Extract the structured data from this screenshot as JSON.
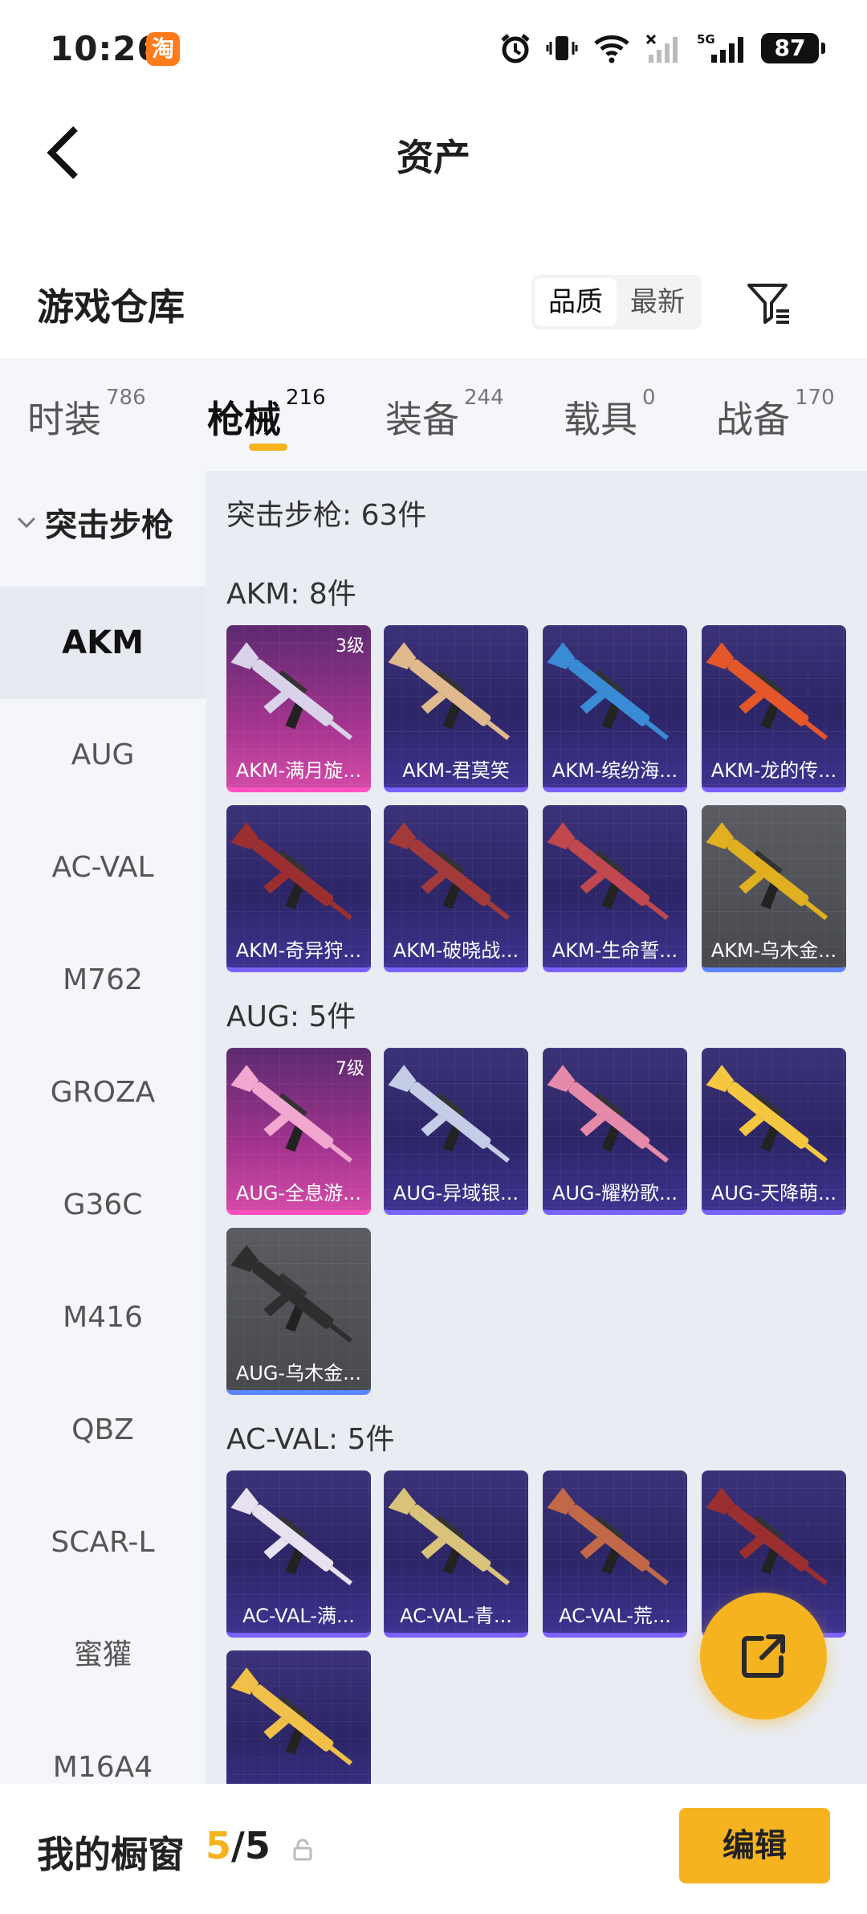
{
  "status_bar": {
    "time": "10:26",
    "app_badge": "淘",
    "battery": "87",
    "network": "5G"
  },
  "nav": {
    "title": "资产",
    "back_icon": "chevron-left-icon"
  },
  "warehouse": {
    "title": "游戏仓库",
    "sort_options": [
      "品质",
      "最新"
    ],
    "selected_sort": "品质"
  },
  "tabs": [
    {
      "label": "时装",
      "count": "786"
    },
    {
      "label": "枪械",
      "count": "216"
    },
    {
      "label": "装备",
      "count": "244"
    },
    {
      "label": "载具",
      "count": "0"
    },
    {
      "label": "战备",
      "count": "170"
    }
  ],
  "active_tab": "枪械",
  "sidebar": {
    "group": "突击步枪",
    "items": [
      "AKM",
      "AUG",
      "AC-VAL",
      "M762",
      "GROZA",
      "G36C",
      "M416",
      "QBZ",
      "SCAR-L",
      "蜜獾",
      "M16A4"
    ],
    "active": "AKM"
  },
  "content": {
    "summary": "突击步枪: 63件",
    "groups": [
      {
        "title": "AKM: 8件",
        "items": [
          {
            "name": "AKM-满月旋...",
            "level": "3级",
            "rarity": "pink"
          },
          {
            "name": "AKM-君莫笑",
            "level": "",
            "rarity": "purple"
          },
          {
            "name": "AKM-缤纷海...",
            "level": "",
            "rarity": "purple"
          },
          {
            "name": "AKM-龙的传...",
            "level": "",
            "rarity": "purple"
          },
          {
            "name": "AKM-奇异狩...",
            "level": "",
            "rarity": "purple"
          },
          {
            "name": "AKM-破晓战...",
            "level": "",
            "rarity": "purple"
          },
          {
            "name": "AKM-生命誓...",
            "level": "",
            "rarity": "purple"
          },
          {
            "name": "AKM-乌木金...",
            "level": "",
            "rarity": "gray"
          }
        ]
      },
      {
        "title": "AUG: 5件",
        "items": [
          {
            "name": "AUG-全息游...",
            "level": "7级",
            "rarity": "pink"
          },
          {
            "name": "AUG-异域银...",
            "level": "",
            "rarity": "purple"
          },
          {
            "name": "AUG-耀粉歌...",
            "level": "",
            "rarity": "purple"
          },
          {
            "name": "AUG-天降萌...",
            "level": "",
            "rarity": "purple"
          },
          {
            "name": "AUG-乌木金...",
            "level": "",
            "rarity": "gray"
          }
        ]
      },
      {
        "title": "AC-VAL: 5件",
        "items": [
          {
            "name": "AC-VAL-满...",
            "level": "",
            "rarity": "purple"
          },
          {
            "name": "AC-VAL-青...",
            "level": "",
            "rarity": "purple"
          },
          {
            "name": "AC-VAL-荒...",
            "level": "",
            "rarity": "purple"
          },
          {
            "name": "...",
            "level": "",
            "rarity": "purple"
          },
          {
            "name": "",
            "level": "",
            "rarity": "purple"
          }
        ]
      }
    ]
  },
  "gun_colors": [
    "#d9d2ea",
    "#e0b98c",
    "#3a8bd6",
    "#e3572a",
    "#9b2f2f",
    "#a33a3a",
    "#c0484e",
    "#e0b020",
    "#f2a7d0",
    "#c5cde6",
    "#e58aa8",
    "#f5c640",
    "#2e2e2e",
    "#e8e2f0",
    "#d9c27a",
    "#c06848",
    "#d8b040",
    "#f0c048"
  ],
  "bottom_bar": {
    "label": "我的橱窗",
    "count_current": "5",
    "count_total": "/5",
    "edit_label": "编辑",
    "lock_icon": "lock-icon"
  },
  "fab": {
    "icon": "share-icon"
  }
}
